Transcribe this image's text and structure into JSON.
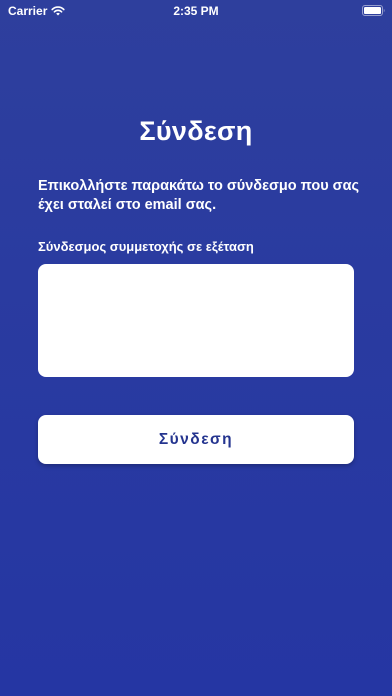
{
  "status_bar": {
    "carrier": "Carrier",
    "time": "2:35 PM"
  },
  "screen": {
    "title": "Σύνδεση",
    "instructions": "Επικολλήστε παρακάτω το σύνδεσμο που σας έχει σταλεί στο email σας.",
    "field_label": "Σύνδεσμος συμμετοχής σε εξέταση",
    "field_value": "",
    "button_label": "Σύνδεση"
  },
  "colors": {
    "background_top": "#2e3f9d",
    "background_bottom": "#2536a3",
    "button_text": "#24348f"
  },
  "icons": {
    "wifi": "wifi-icon",
    "battery": "battery-icon"
  }
}
